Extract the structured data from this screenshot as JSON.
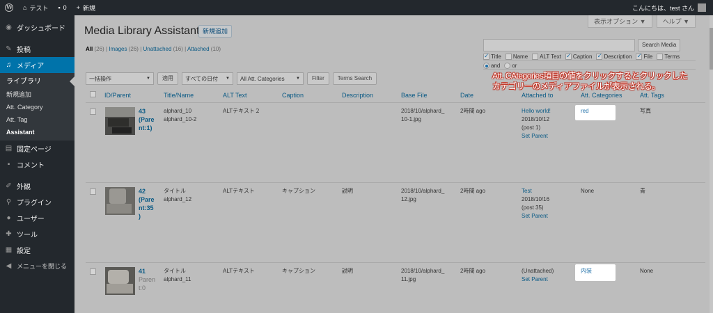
{
  "adminbar": {
    "site_name": "テスト",
    "comments_count": "0",
    "new_label": "新規",
    "greeting": "こんにちは、test さん"
  },
  "sidebar": {
    "dashboard": "ダッシュボード",
    "posts": "投稿",
    "media": "メディア",
    "media_sub": [
      "ライブラリ",
      "新規追加",
      "Att. Category",
      "Att. Tag",
      "Assistant"
    ],
    "pages": "固定ページ",
    "comments": "コメント",
    "appearance": "外観",
    "plugins": "プラグイン",
    "users": "ユーザー",
    "tools": "ツール",
    "settings": "設定",
    "collapse": "メニューを閉じる"
  },
  "header": {
    "title": "Media Library Assistant",
    "add_new": "新規追加",
    "screen_options": "表示オプション ▼",
    "help": "ヘルプ ▼"
  },
  "filters": {
    "all": "All",
    "all_count": "(26)",
    "images": "Images",
    "images_count": "(26)",
    "unattached": "Unattached",
    "unattached_count": "(16)",
    "attached": "Attached",
    "attached_count": "(10)",
    "sep": "|"
  },
  "search": {
    "button": "Search Media",
    "options": [
      {
        "label": "Title",
        "checked": true
      },
      {
        "label": "Name",
        "checked": false
      },
      {
        "label": "ALT Text",
        "checked": false
      },
      {
        "label": "Caption",
        "checked": true
      },
      {
        "label": "Description",
        "checked": true
      },
      {
        "label": "File",
        "checked": true
      },
      {
        "label": "Terms",
        "checked": false
      }
    ],
    "and_label": "and",
    "or_label": "or"
  },
  "tablenav": {
    "bulk": "一括操作",
    "apply": "適用",
    "dates": "すべての日付",
    "categories": "All Att. Categories",
    "filter": "Filter",
    "terms_search": "Terms Search"
  },
  "columns": [
    "ID/Parent",
    "Title/Name",
    "ALT Text",
    "Caption",
    "Description",
    "Base File",
    "Date",
    "Attached to",
    "Att. Categories",
    "Att. Tags"
  ],
  "rows": [
    {
      "id": "43",
      "parent1": "(Pare",
      "parent2": "nt:1)",
      "parent3": "",
      "title": "alphard_10",
      "name": "alphard_10-2",
      "alt": "ALTテキスト２",
      "caption": "",
      "description": "",
      "file1": "2018/10/alphard_",
      "file2": "10-1.jpg",
      "date": "2時間 ago",
      "attached_title": "Hello world!",
      "attached_date": "2018/10/12",
      "attached_post": "(post 1)",
      "set_parent": "Set Parent",
      "category": "red",
      "tags": "写真"
    },
    {
      "id": "42",
      "parent1": "(Pare",
      "parent2": "nt:35",
      "parent3": ")",
      "title": "タイトル",
      "name": "alphard_12",
      "alt": "ALTテキスト",
      "caption": "キャプション",
      "description": "説明",
      "file1": "2018/10/alphard_",
      "file2": "12.jpg",
      "date": "2時間 ago",
      "attached_title": "Test",
      "attached_date": "2018/10/16",
      "attached_post": "(post 35)",
      "set_parent": "Set Parent",
      "category": "None",
      "tags": "青"
    },
    {
      "id": "41",
      "parent1": "Paren",
      "parent2": "t:0",
      "parent3": "",
      "title": "タイトル",
      "name": "alphard_11",
      "alt": "ALTテキスト",
      "caption": "キャプション",
      "description": "説明",
      "file1": "2018/10/alphard_",
      "file2": "11.jpg",
      "date": "2時間 ago",
      "attached_title": "(Unattached)",
      "attached_date": "",
      "attached_post": "",
      "set_parent": "Set Parent",
      "category": "内装",
      "tags": "None"
    }
  ],
  "annotation": {
    "line1": "Att. CAtegories項目の値をクリックするとクリックした",
    "line2": "カテゴリーのメディアファイルが表示される。"
  },
  "colors": {
    "admin_dark": "#23282d",
    "accent": "#0073aa",
    "link": "#0a5a85",
    "annotation_outline": "#c0392b"
  }
}
